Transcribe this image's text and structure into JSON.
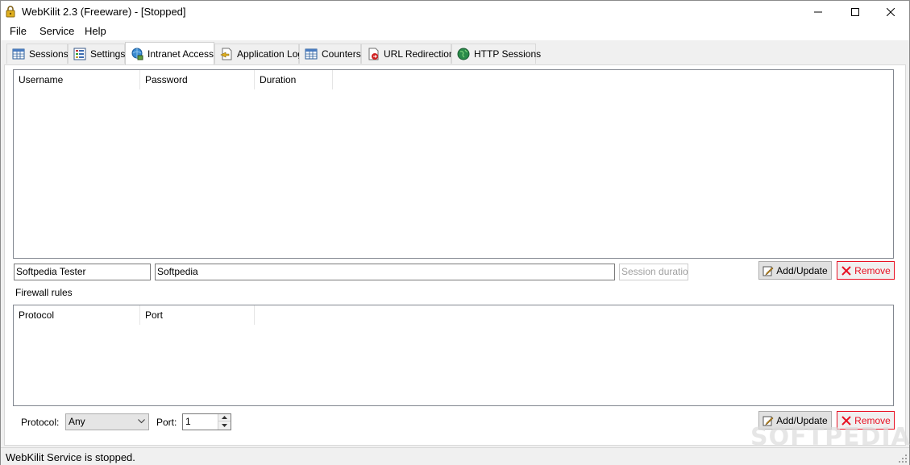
{
  "window": {
    "title": "WebKilit 2.3 (Freeware) - [Stopped]",
    "app_icon": "padlock-icon",
    "controls": [
      "minimize-icon",
      "maximize-icon",
      "close-icon"
    ]
  },
  "menu": {
    "items": [
      "File",
      "Service",
      "Help"
    ]
  },
  "tabs": [
    {
      "label": "Sessions",
      "icon": "table-icon",
      "active": false
    },
    {
      "label": "Settings",
      "icon": "settings-list-icon",
      "active": false
    },
    {
      "label": "Intranet Access",
      "icon": "network-icon",
      "active": true
    },
    {
      "label": "Application Log",
      "icon": "log-icon",
      "active": false
    },
    {
      "label": "Counters",
      "icon": "table-icon",
      "active": false
    },
    {
      "label": "URL Redirection",
      "icon": "redirect-icon",
      "active": false
    },
    {
      "label": "HTTP Sessions",
      "icon": "globe-icon",
      "active": false
    }
  ],
  "users": {
    "columns": [
      "Username",
      "Password",
      "Duration"
    ],
    "rows": []
  },
  "user_form": {
    "username_value": "Softpedia Tester",
    "password_value": "Softpedia",
    "duration_placeholder": "Session duration",
    "add_update_label": "Add/Update",
    "remove_label": "Remove"
  },
  "firewall": {
    "section_label": "Firewall rules",
    "columns": [
      "Protocol",
      "Port"
    ],
    "rows": []
  },
  "firewall_form": {
    "protocol_label": "Protocol:",
    "protocol_value": "Any",
    "port_label": "Port:",
    "port_value": "1",
    "add_update_label": "Add/Update",
    "remove_label": "Remove"
  },
  "status": {
    "text": "WebKilit Service is stopped."
  },
  "watermark": {
    "text": "SOFTPEDIA"
  },
  "colors": {
    "remove_accent": "#e81123",
    "border": "#828790"
  }
}
